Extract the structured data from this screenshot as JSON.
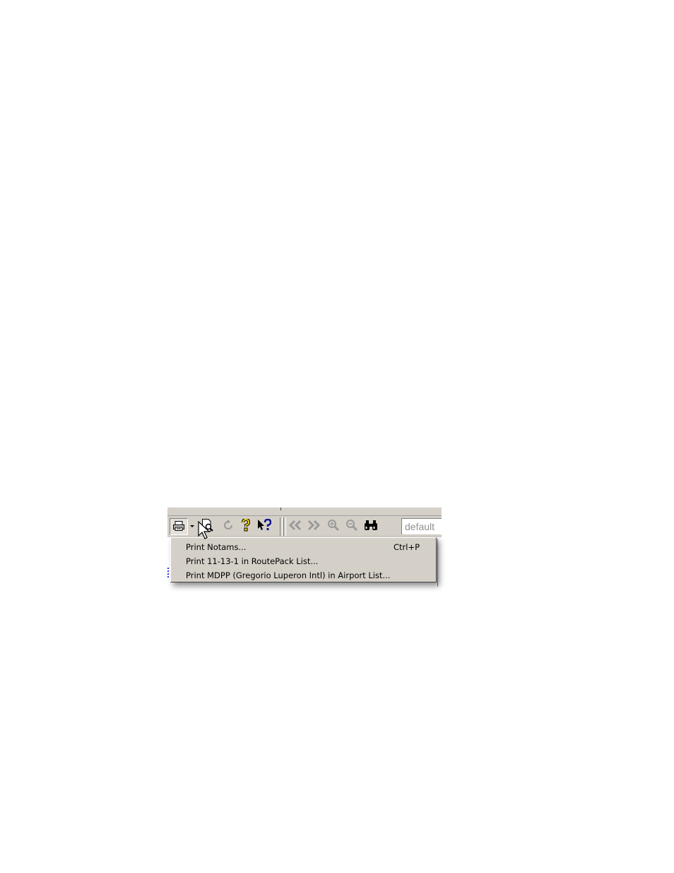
{
  "toolbar": {
    "buttons": [
      {
        "name": "print-icon",
        "glyph": "🖶",
        "state": "pressed"
      },
      {
        "name": "print-preview-icon",
        "glyph": "🗋"
      },
      {
        "name": "refresh-icon",
        "glyph": "↻",
        "state": "disabled"
      },
      {
        "name": "help-icon",
        "glyph": "?"
      },
      {
        "name": "context-help-icon",
        "glyph": "?"
      },
      {
        "name": "back-icon",
        "glyph": "«",
        "state": "disabled"
      },
      {
        "name": "forward-icon",
        "glyph": "»",
        "state": "disabled"
      },
      {
        "name": "zoom-in-icon",
        "glyph": "🔍",
        "state": "disabled"
      },
      {
        "name": "zoom-out-icon",
        "glyph": "🔍",
        "state": "disabled"
      },
      {
        "name": "find-icon",
        "glyph": "👓"
      }
    ],
    "profile_value": "default"
  },
  "print_menu": {
    "items": [
      {
        "label": "Print Notams...",
        "shortcut": "Ctrl+P"
      },
      {
        "label": "Print 11-13-1 in RoutePack List...",
        "shortcut": ""
      },
      {
        "label": "Print MDPP (Gregorio Luperon Intl) in Airport List...",
        "shortcut": ""
      }
    ]
  },
  "colors": {
    "chrome": "#d4d0c8",
    "help_yellow": "#c8a000",
    "help_blue": "#10108a",
    "disabled": "#9a9a9a"
  }
}
